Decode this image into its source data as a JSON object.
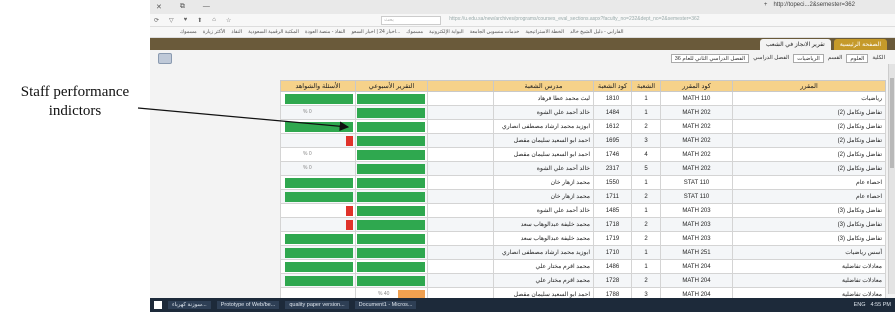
{
  "annotation": {
    "line1": "Staff performance",
    "line2": "indictors"
  },
  "browser": {
    "window_buttons": [
      "✕",
      "⧉",
      "—"
    ],
    "tab_title": "http://topeci...2&semester=362",
    "new_tab": "+",
    "nav": [
      "⟳",
      "▽",
      "♥",
      "⬆",
      "⌂",
      "☆"
    ],
    "search_placeholder": "بحث",
    "url": "https://u.edu.sa/new/archives/programs/courses_eval_sections.aspx?faculty_no=232&dept_no=2&semester=362",
    "bookmarks": [
      "مسموك",
      "الأكثر زيارة",
      "النفاذ",
      "المكتبة الرقمية السعودية",
      "النفاذ - منصة العودة",
      "اخبار 24 | اخبار السعو...",
      "مسموك",
      "البوابة الإلكترونية",
      "خدمات منسوبي الجامعة",
      "الخطة الاستراتيجية",
      "الفارابي - دليل الشيخ خالد"
    ]
  },
  "app": {
    "tabs": [
      "الصفحة الرئيسية",
      "تقرير الانجاز في الشعب"
    ],
    "filters": [
      "الكلية",
      "العلوم",
      "القسم",
      "الرياضيات",
      "الفصل الدراسي",
      "الفصل الدراسي الثاني للعام 36"
    ]
  },
  "grid": {
    "headers": [
      "المقرر",
      "كود المقرر",
      "الشعبة",
      "كود الشعبة",
      "مدرس الشعبة",
      "التقرير الأسبوعي",
      "الأسئلة والشواهد"
    ],
    "rows": [
      {
        "course": "رياضيات",
        "code": "MATH 110",
        "sec": "1",
        "sec_code": "1810",
        "teacher": "ليث محمد عطا فرهاد",
        "weekly": 1.0,
        "weekly_color": "green",
        "evidence": 1.0,
        "evidence_color": "green"
      },
      {
        "course": "تفاضل وتكامل (2)",
        "code": "MATH 202",
        "sec": "1",
        "sec_code": "1484",
        "teacher": "خالد أحمد علي الشوة",
        "weekly": 1.0,
        "weekly_color": "green",
        "evidence": 0.0,
        "evidence_color": "none",
        "evidence_text": "% 0"
      },
      {
        "course": "تفاضل وتكامل (2)",
        "code": "MATH 202",
        "sec": "2",
        "sec_code": "1612",
        "teacher": "ابوزيد محمد ارشاد مصطفى انصاري",
        "weekly": 1.0,
        "weekly_color": "green",
        "evidence": 1.0,
        "evidence_color": "green"
      },
      {
        "course": "تفاضل وتكامل (2)",
        "code": "MATH 202",
        "sec": "3",
        "sec_code": "1695",
        "teacher": "احمد ابو السعيد سليمان مقصل",
        "weekly": 1.0,
        "weekly_color": "green",
        "evidence": 0.1,
        "evidence_color": "red"
      },
      {
        "course": "تفاضل وتكامل (2)",
        "code": "MATH 202",
        "sec": "4",
        "sec_code": "1746",
        "teacher": "احمد ابو السعيد سليمان مقصل",
        "weekly": 1.0,
        "weekly_color": "green",
        "evidence": 0.0,
        "evidence_color": "none",
        "evidence_text": "% 0"
      },
      {
        "course": "تفاضل وتكامل (2)",
        "code": "MATH 202",
        "sec": "5",
        "sec_code": "2317",
        "teacher": "خالد أحمد علي الشوة",
        "weekly": 1.0,
        "weekly_color": "green",
        "evidence": 0.0,
        "evidence_color": "none",
        "evidence_text": "% 0"
      },
      {
        "course": "احصاء عام",
        "code": "STAT 110",
        "sec": "1",
        "sec_code": "1550",
        "teacher": "محمد ازهار خان",
        "weekly": 1.0,
        "weekly_color": "green",
        "evidence": 1.0,
        "evidence_color": "green"
      },
      {
        "course": "احصاء عام",
        "code": "STAT 110",
        "sec": "2",
        "sec_code": "1711",
        "teacher": "محمد ازهار خان",
        "weekly": 1.0,
        "weekly_color": "green",
        "evidence": 1.0,
        "evidence_color": "green"
      },
      {
        "course": "تفاضل وتكامل (3)",
        "code": "MATH 203",
        "sec": "1",
        "sec_code": "1485",
        "teacher": "خالد أحمد علي الشوة",
        "weekly": 1.0,
        "weekly_color": "green",
        "evidence": 0.1,
        "evidence_color": "red"
      },
      {
        "course": "تفاضل وتكامل (3)",
        "code": "MATH 203",
        "sec": "2",
        "sec_code": "1718",
        "teacher": "محمد خليفة عبدالوهاب سعد",
        "weekly": 1.0,
        "weekly_color": "green",
        "evidence": 0.1,
        "evidence_color": "red"
      },
      {
        "course": "تفاضل وتكامل (3)",
        "code": "MATH 203",
        "sec": "2",
        "sec_code": "1719",
        "teacher": "محمد خليفة عبدالوهاب سعد",
        "weekly": 1.0,
        "weekly_color": "green",
        "evidence": 1.0,
        "evidence_color": "green"
      },
      {
        "course": "أسس رياضيات",
        "code": "MATH 251",
        "sec": "1",
        "sec_code": "1710",
        "teacher": "ابوزيد محمد ارشاد مصطفى انصاري",
        "weekly": 1.0,
        "weekly_color": "green",
        "evidence": 1.0,
        "evidence_color": "green"
      },
      {
        "course": "معادلات تفاضلية",
        "code": "MATH 204",
        "sec": "1",
        "sec_code": "1486",
        "teacher": "محمد اقرم مختار علي",
        "weekly": 1.0,
        "weekly_color": "green",
        "evidence": 1.0,
        "evidence_color": "green"
      },
      {
        "course": "معادلات تفاضلية",
        "code": "MATH 204",
        "sec": "2",
        "sec_code": "1728",
        "teacher": "محمد اقرم مختار علي",
        "weekly": 1.0,
        "weekly_color": "green",
        "evidence": 1.0,
        "evidence_color": "green"
      },
      {
        "course": "معادلات تفاضلية",
        "code": "MATH 204",
        "sec": "3",
        "sec_code": "1788",
        "teacher": "احمد ابو السعيد سليمان مقصل",
        "weekly": 0.4,
        "weekly_color": "orange",
        "weekly_text": "% 40",
        "evidence": 0.0,
        "evidence_color": "none"
      }
    ]
  },
  "taskbar": {
    "items": [
      "سوزنة كهرباء...",
      "Prototype of Web/be...",
      "quality paper version...",
      "Document1 - Micros..."
    ],
    "clock": "4:55 PM",
    "lang": "ENG"
  }
}
